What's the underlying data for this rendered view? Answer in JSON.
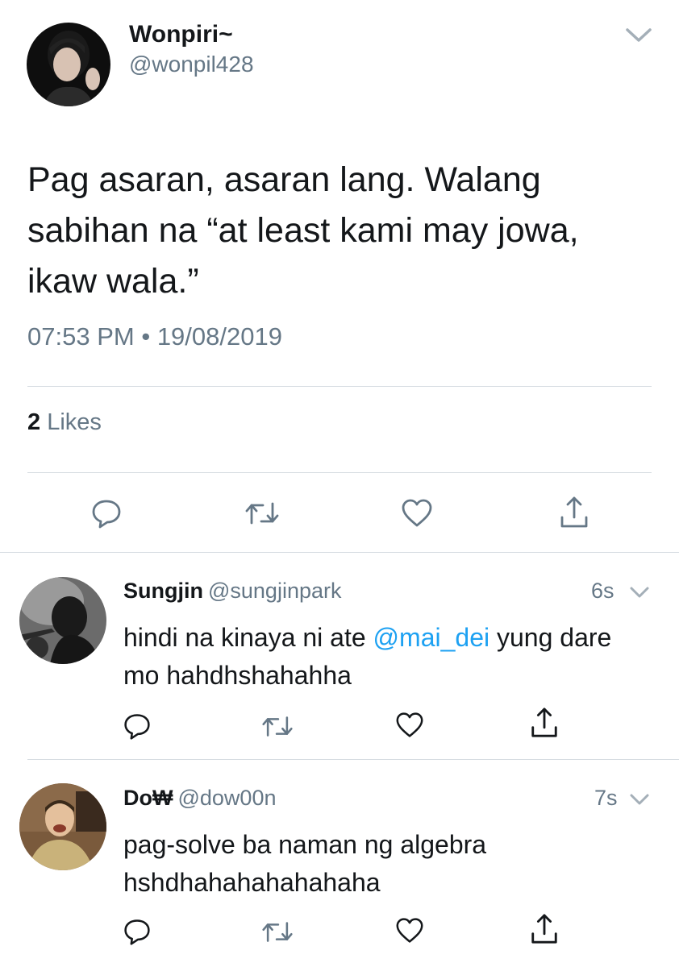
{
  "main_tweet": {
    "display_name": "Wonpiri~",
    "handle": "@wonpil428",
    "text": "Pag asaran, asaran lang. Walang sabihan na “at least kami may jowa, ikaw wala.”",
    "time": "07:53 PM",
    "separator": "•",
    "date": "19/08/2019",
    "likes_count": "2",
    "likes_label": "Likes",
    "icons": {
      "menu": "chevron-down-icon",
      "reply": "reply-icon",
      "retweet": "retweet-icon",
      "like": "heart-icon",
      "share": "share-icon"
    }
  },
  "replies": [
    {
      "display_name": "Sungjin",
      "handle": "@sungjinpark",
      "time": "6s",
      "text_before": "hindi na kinaya ni ate ",
      "mention": "@mai_dei",
      "text_after": " yung dare mo hahdhshahahha"
    },
    {
      "display_name": "Do₩",
      "handle": "@dow00n",
      "time": "7s",
      "text": "pag-solve ba naman ng algebra hshdhahahahahahaha"
    }
  ],
  "colors": {
    "text": "#14171a",
    "secondary": "#657786",
    "link": "#1da1f2",
    "divider": "#d7dde2"
  }
}
